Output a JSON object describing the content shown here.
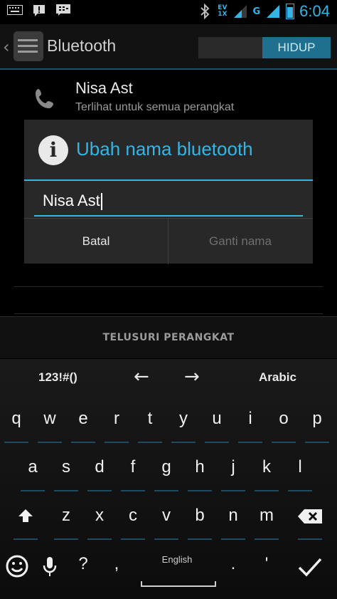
{
  "status_bar": {
    "net_type_top": "EV",
    "net_type_bottom": "1X",
    "net_g": "G",
    "time": "6:04"
  },
  "action_bar": {
    "title": "Bluetooth",
    "toggle_label": "HIDUP"
  },
  "device": {
    "name": "Nisa Ast",
    "subtitle": "Terlihat untuk semua perangkat"
  },
  "scan_button": "TELUSURI PERANGKAT",
  "dialog": {
    "title": "Ubah nama bluetooth",
    "input_value": "Nisa Ast",
    "cancel_label": "Batal",
    "rename_label": "Ganti nama"
  },
  "keyboard": {
    "symbols_label": "123!#()",
    "left_arrow": "←",
    "right_arrow": "→",
    "language_switch": "Arabic",
    "row1": [
      "q",
      "w",
      "e",
      "r",
      "t",
      "y",
      "u",
      "i",
      "o",
      "p"
    ],
    "row2": [
      "a",
      "s",
      "d",
      "f",
      "g",
      "h",
      "j",
      "k",
      "l"
    ],
    "row3": [
      "z",
      "x",
      "c",
      "v",
      "b",
      "n",
      "m"
    ],
    "question": "?",
    "comma": ",",
    "space_label": "English",
    "period": ".",
    "apostrophe": "'"
  },
  "colors": {
    "accent": "#33b5e5",
    "background": "#000000",
    "dialog": "#282828"
  },
  "icons": [
    "keyboard-icon",
    "notification-icon",
    "bbm-icon",
    "bluetooth-icon",
    "signal-icon",
    "battery-icon",
    "phone-icon",
    "info-icon",
    "shift-icon",
    "backspace-icon",
    "emoji-icon",
    "mic-icon",
    "enter-check-icon"
  ]
}
